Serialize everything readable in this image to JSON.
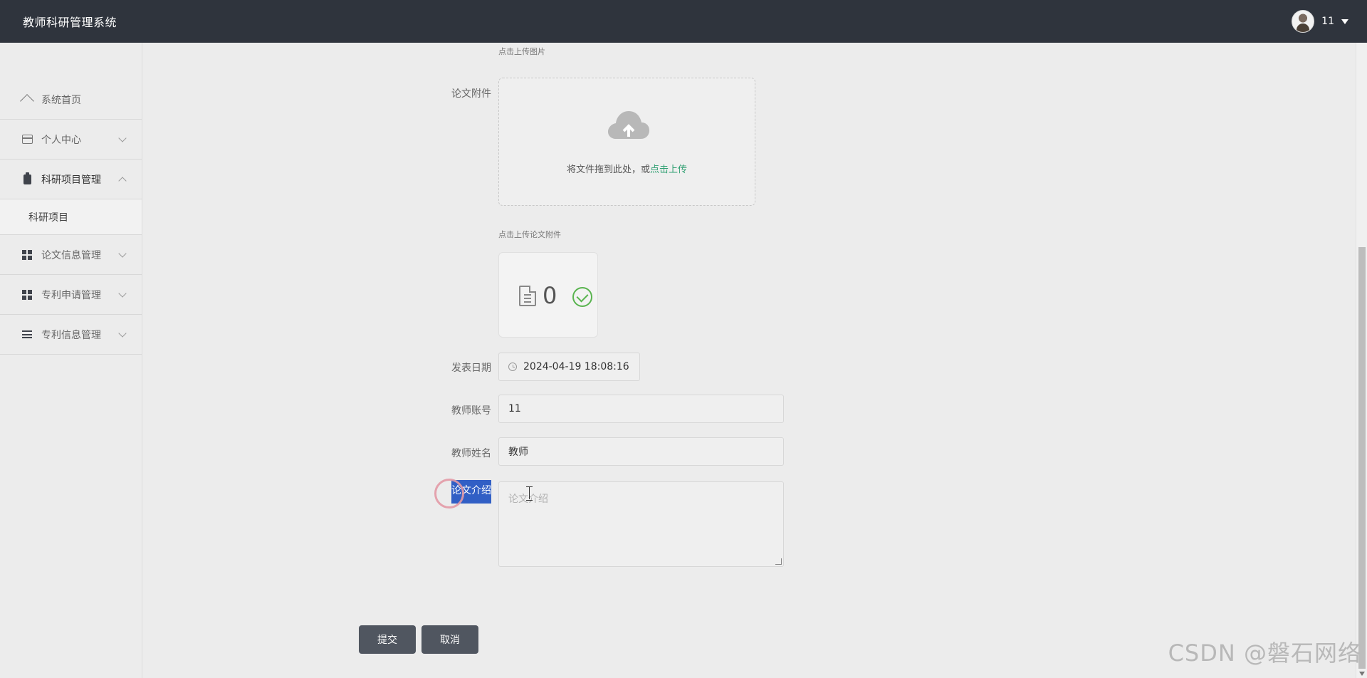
{
  "app": {
    "title": "教师科研管理系统"
  },
  "user": {
    "name": "11"
  },
  "sidebar": {
    "items": [
      {
        "label": "系统首页",
        "icon": "home-icon"
      },
      {
        "label": "个人中心",
        "icon": "card-icon"
      },
      {
        "label": "科研项目管理",
        "icon": "clipboard-icon"
      },
      {
        "label": "论文信息管理",
        "icon": "grid-icon"
      },
      {
        "label": "专利申请管理",
        "icon": "grid-icon"
      },
      {
        "label": "专利信息管理",
        "icon": "list-icon"
      }
    ],
    "submenu": {
      "label": "科研项目"
    }
  },
  "form": {
    "image_hint": "点击上传图片",
    "attachment": {
      "label": "论文附件",
      "upload_text": "将文件拖到此处，或",
      "upload_link": "点击上传",
      "hint": "点击上传论文附件",
      "file_count": "0"
    },
    "publish_date": {
      "label": "发表日期",
      "value": "2024-04-19 18:08:16"
    },
    "teacher_account": {
      "label": "教师账号",
      "value": "11"
    },
    "teacher_name": {
      "label": "教师姓名",
      "value": "教师"
    },
    "paper_intro": {
      "label": "论文介绍",
      "placeholder": "论文介绍"
    },
    "buttons": {
      "submit": "提交",
      "cancel": "取消"
    }
  },
  "watermark": "CSDN @磐石网络",
  "colors": {
    "topbar": "#2f343d",
    "accent": "#2f9f71",
    "selection": "#315fc5",
    "success": "#59b44f"
  }
}
